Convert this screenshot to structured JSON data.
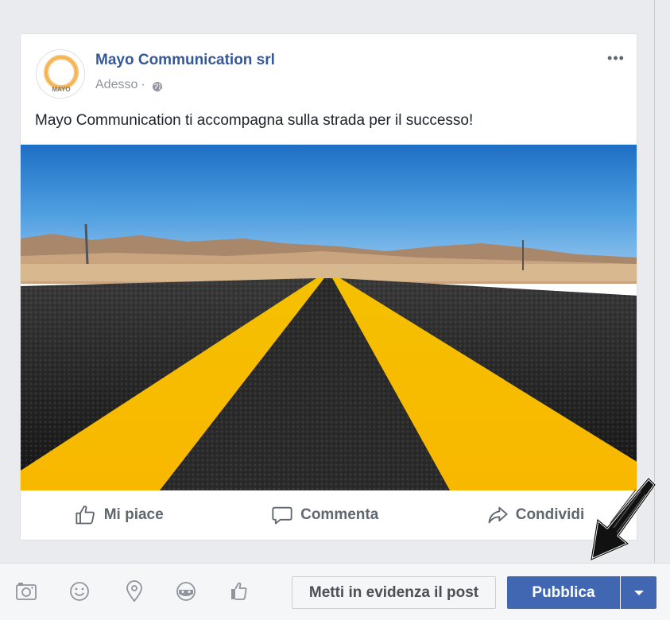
{
  "post": {
    "page_name": "Mayo Communication srl",
    "timestamp": "Adesso",
    "separator": "·",
    "privacy_icon": "globe-icon",
    "more_label": "•••",
    "text": "Mayo Communication ti accompagna sulla strada per il successo!",
    "avatar_logo_text": "MAYO",
    "image_description_icon": "road-photo"
  },
  "actions": {
    "like_label": "Mi piace",
    "comment_label": "Commenta",
    "share_label": "Condividi"
  },
  "composer_toolbar": {
    "icons": [
      "camera-icon",
      "emoji-icon",
      "location-pin-icon",
      "sticker-icon",
      "thumbs-up-cup-icon"
    ],
    "boost_label": "Metti in evidenza il post",
    "publish_label": "Pubblica"
  },
  "colors": {
    "brand_blue": "#4267b2",
    "link_blue": "#365899",
    "avatar_ring": "#f5a623"
  }
}
